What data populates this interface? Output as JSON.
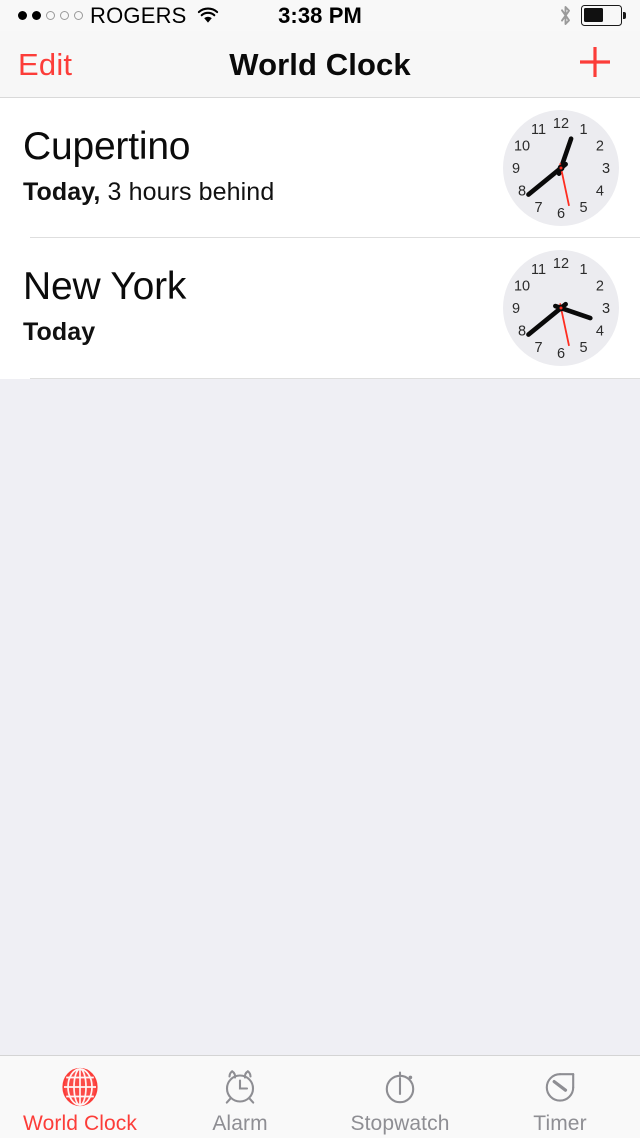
{
  "status_bar": {
    "signal_dots": {
      "filled": 2,
      "total": 5
    },
    "carrier": "ROGERS",
    "wifi_icon": "wifi-icon",
    "time": "3:38 PM",
    "bluetooth_icon": "bluetooth-icon",
    "battery_icon": "battery-icon",
    "battery_percent": 55
  },
  "nav_bar": {
    "edit_label": "Edit",
    "title": "World Clock",
    "add_icon": "plus-icon",
    "accent_color": "#FC3D39"
  },
  "clocks": [
    {
      "city": "Cupertino",
      "day_label": "Today,",
      "offset_label": " 3 hours behind",
      "time": {
        "hour": 12,
        "minute": 38,
        "second": 28
      }
    },
    {
      "city": "New York",
      "day_label": "Today",
      "offset_label": "",
      "time": {
        "hour": 3,
        "minute": 38,
        "second": 28
      }
    }
  ],
  "clock_face": {
    "numerals": [
      "12",
      "1",
      "2",
      "3",
      "4",
      "5",
      "6",
      "7",
      "8",
      "9",
      "10",
      "11"
    ],
    "face_color": "#ECECF0",
    "hand_color": "#0a0a0a",
    "second_hand_color": "#FF2D20"
  },
  "tab_bar": {
    "items": [
      {
        "label": "World Clock",
        "icon": "globe-icon",
        "active": true
      },
      {
        "label": "Alarm",
        "icon": "alarm-clock-icon",
        "active": false
      },
      {
        "label": "Stopwatch",
        "icon": "stopwatch-icon",
        "active": false
      },
      {
        "label": "Timer",
        "icon": "timer-icon",
        "active": false
      }
    ],
    "active_color": "#FC3D39",
    "inactive_color": "#8E8E93"
  }
}
